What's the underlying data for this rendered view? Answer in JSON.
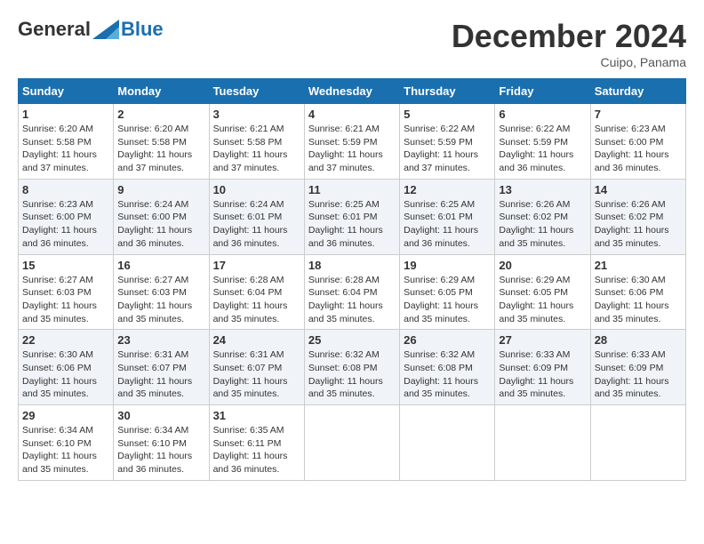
{
  "logo": {
    "general": "General",
    "blue": "Blue"
  },
  "header": {
    "month": "December 2024",
    "location": "Cuipo, Panama"
  },
  "weekdays": [
    "Sunday",
    "Monday",
    "Tuesday",
    "Wednesday",
    "Thursday",
    "Friday",
    "Saturday"
  ],
  "weeks": [
    [
      {
        "day": "1",
        "sunrise": "6:20 AM",
        "sunset": "5:58 PM",
        "daylight": "11 hours and 37 minutes."
      },
      {
        "day": "2",
        "sunrise": "6:20 AM",
        "sunset": "5:58 PM",
        "daylight": "11 hours and 37 minutes."
      },
      {
        "day": "3",
        "sunrise": "6:21 AM",
        "sunset": "5:58 PM",
        "daylight": "11 hours and 37 minutes."
      },
      {
        "day": "4",
        "sunrise": "6:21 AM",
        "sunset": "5:59 PM",
        "daylight": "11 hours and 37 minutes."
      },
      {
        "day": "5",
        "sunrise": "6:22 AM",
        "sunset": "5:59 PM",
        "daylight": "11 hours and 37 minutes."
      },
      {
        "day": "6",
        "sunrise": "6:22 AM",
        "sunset": "5:59 PM",
        "daylight": "11 hours and 36 minutes."
      },
      {
        "day": "7",
        "sunrise": "6:23 AM",
        "sunset": "6:00 PM",
        "daylight": "11 hours and 36 minutes."
      }
    ],
    [
      {
        "day": "8",
        "sunrise": "6:23 AM",
        "sunset": "6:00 PM",
        "daylight": "11 hours and 36 minutes."
      },
      {
        "day": "9",
        "sunrise": "6:24 AM",
        "sunset": "6:00 PM",
        "daylight": "11 hours and 36 minutes."
      },
      {
        "day": "10",
        "sunrise": "6:24 AM",
        "sunset": "6:01 PM",
        "daylight": "11 hours and 36 minutes."
      },
      {
        "day": "11",
        "sunrise": "6:25 AM",
        "sunset": "6:01 PM",
        "daylight": "11 hours and 36 minutes."
      },
      {
        "day": "12",
        "sunrise": "6:25 AM",
        "sunset": "6:01 PM",
        "daylight": "11 hours and 36 minutes."
      },
      {
        "day": "13",
        "sunrise": "6:26 AM",
        "sunset": "6:02 PM",
        "daylight": "11 hours and 35 minutes."
      },
      {
        "day": "14",
        "sunrise": "6:26 AM",
        "sunset": "6:02 PM",
        "daylight": "11 hours and 35 minutes."
      }
    ],
    [
      {
        "day": "15",
        "sunrise": "6:27 AM",
        "sunset": "6:03 PM",
        "daylight": "11 hours and 35 minutes."
      },
      {
        "day": "16",
        "sunrise": "6:27 AM",
        "sunset": "6:03 PM",
        "daylight": "11 hours and 35 minutes."
      },
      {
        "day": "17",
        "sunrise": "6:28 AM",
        "sunset": "6:04 PM",
        "daylight": "11 hours and 35 minutes."
      },
      {
        "day": "18",
        "sunrise": "6:28 AM",
        "sunset": "6:04 PM",
        "daylight": "11 hours and 35 minutes."
      },
      {
        "day": "19",
        "sunrise": "6:29 AM",
        "sunset": "6:05 PM",
        "daylight": "11 hours and 35 minutes."
      },
      {
        "day": "20",
        "sunrise": "6:29 AM",
        "sunset": "6:05 PM",
        "daylight": "11 hours and 35 minutes."
      },
      {
        "day": "21",
        "sunrise": "6:30 AM",
        "sunset": "6:06 PM",
        "daylight": "11 hours and 35 minutes."
      }
    ],
    [
      {
        "day": "22",
        "sunrise": "6:30 AM",
        "sunset": "6:06 PM",
        "daylight": "11 hours and 35 minutes."
      },
      {
        "day": "23",
        "sunrise": "6:31 AM",
        "sunset": "6:07 PM",
        "daylight": "11 hours and 35 minutes."
      },
      {
        "day": "24",
        "sunrise": "6:31 AM",
        "sunset": "6:07 PM",
        "daylight": "11 hours and 35 minutes."
      },
      {
        "day": "25",
        "sunrise": "6:32 AM",
        "sunset": "6:08 PM",
        "daylight": "11 hours and 35 minutes."
      },
      {
        "day": "26",
        "sunrise": "6:32 AM",
        "sunset": "6:08 PM",
        "daylight": "11 hours and 35 minutes."
      },
      {
        "day": "27",
        "sunrise": "6:33 AM",
        "sunset": "6:09 PM",
        "daylight": "11 hours and 35 minutes."
      },
      {
        "day": "28",
        "sunrise": "6:33 AM",
        "sunset": "6:09 PM",
        "daylight": "11 hours and 35 minutes."
      }
    ],
    [
      {
        "day": "29",
        "sunrise": "6:34 AM",
        "sunset": "6:10 PM",
        "daylight": "11 hours and 35 minutes."
      },
      {
        "day": "30",
        "sunrise": "6:34 AM",
        "sunset": "6:10 PM",
        "daylight": "11 hours and 36 minutes."
      },
      {
        "day": "31",
        "sunrise": "6:35 AM",
        "sunset": "6:11 PM",
        "daylight": "11 hours and 36 minutes."
      },
      null,
      null,
      null,
      null
    ]
  ]
}
